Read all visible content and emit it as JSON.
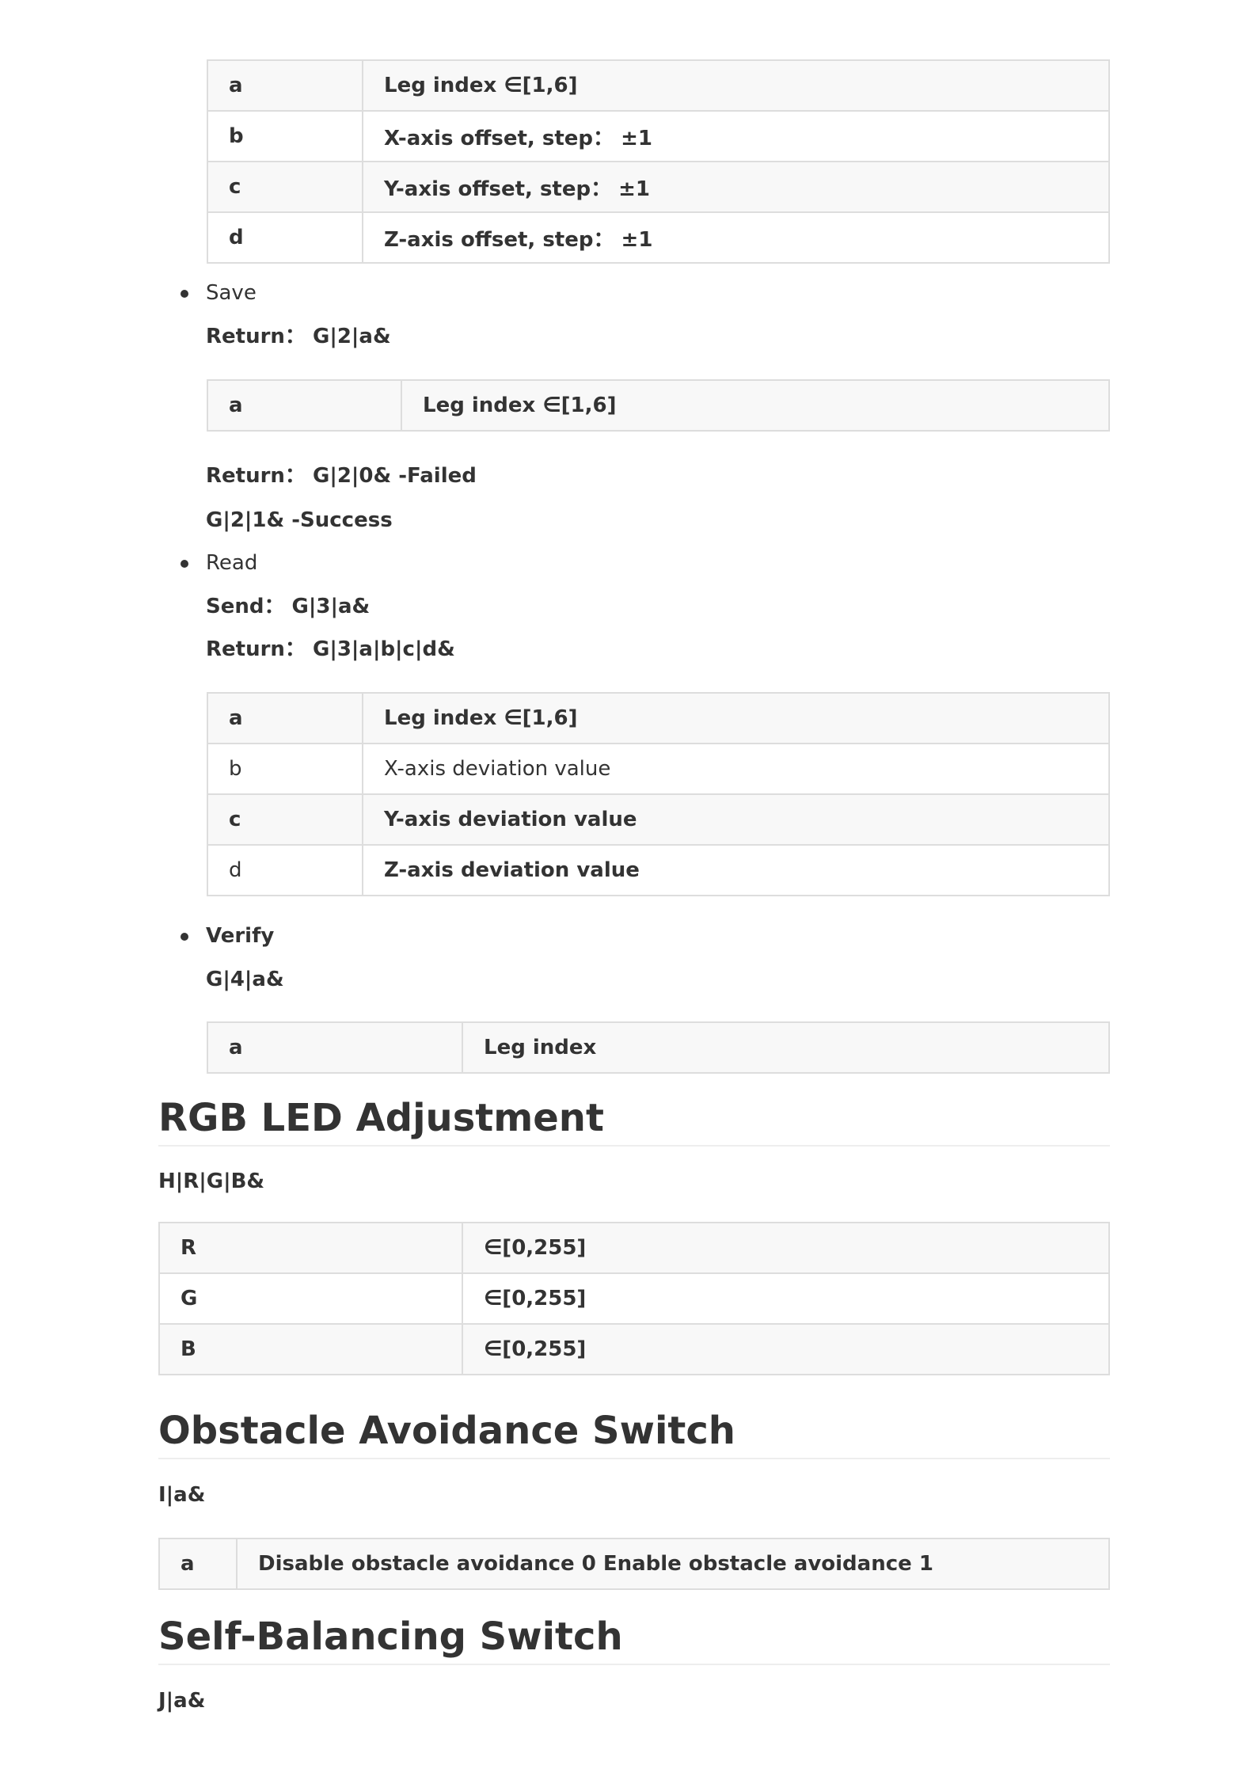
{
  "calibration_table": {
    "rows": [
      {
        "key": "a",
        "value": "Leg index ∈[1,6]"
      },
      {
        "key": "b",
        "value": "X-axis offset, step： ±1"
      },
      {
        "key": "c",
        "value": "Y-axis offset, step： ±1"
      },
      {
        "key": "d",
        "value": "Z-axis offset, step： ±1"
      }
    ]
  },
  "save": {
    "label": "Save",
    "send_line": "Return： G|2|a&",
    "table": {
      "key": "a",
      "value": "Leg index ∈[1,6]"
    },
    "return_failed": "Return： G|2|0& -Failed",
    "return_success": "G|2|1& -Success"
  },
  "read": {
    "label": "Read",
    "send_line": "Send： G|3|a&",
    "return_line": "Return： G|3|a|b|c|d&",
    "rows": [
      {
        "key": "a",
        "value": "Leg index ∈[1,6]"
      },
      {
        "key": "b",
        "value": "X-axis deviation value"
      },
      {
        "key": "c",
        "value": "Y-axis deviation value"
      },
      {
        "key": "d",
        "value": "Z-axis deviation value"
      }
    ]
  },
  "verify": {
    "label": "Verify",
    "command": "G|4|a&",
    "table": {
      "key": "a",
      "value": "Leg index"
    }
  },
  "rgb": {
    "heading": "RGB LED Adjustment",
    "command": "H|R|G|B&",
    "rows": [
      {
        "key": "R",
        "value": "∈[0,255]"
      },
      {
        "key": "G",
        "value": "∈[0,255]"
      },
      {
        "key": "B",
        "value": "∈[0,255]"
      }
    ]
  },
  "obstacle": {
    "heading": "Obstacle Avoidance Switch",
    "command": "I|a&",
    "table": {
      "key": "a",
      "value": "Disable obstacle avoidance 0 Enable obstacle avoidance 1"
    }
  },
  "balance": {
    "heading": "Self-Balancing Switch",
    "command": "J|a&"
  }
}
